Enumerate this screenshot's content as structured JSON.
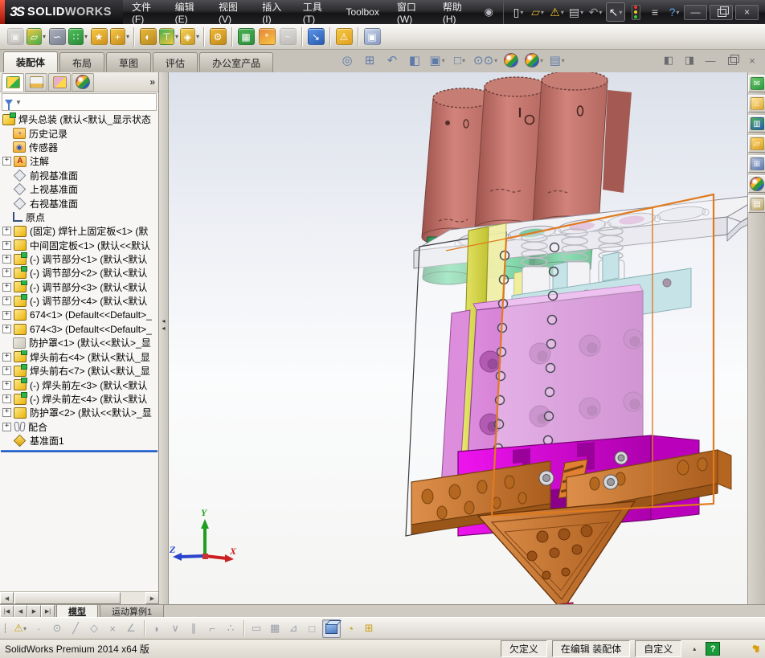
{
  "titlebar": {
    "logo_mark": "3S",
    "logo_brand_a": "SOLID",
    "logo_brand_b": "WORKS",
    "menus": [
      "文件(F)",
      "编辑(E)",
      "视图(V)",
      "插入(I)",
      "工具(T)",
      "Toolbox",
      "窗口(W)",
      "帮助(H)"
    ],
    "quick_tools": [
      {
        "name": "new-document",
        "glyph": "▯",
        "color": "#e8e8ec",
        "dropdown": true
      },
      {
        "name": "open",
        "glyph": "▱",
        "color": "#e8b83a",
        "dropdown": true
      },
      {
        "name": "save",
        "glyph": "⚠",
        "color": "#f0c030",
        "dropdown": true
      },
      {
        "name": "print",
        "glyph": "▤",
        "color": "#c8c8cc",
        "dropdown": true
      },
      {
        "name": "undo",
        "glyph": "↶",
        "color": "#9a9aa0",
        "dropdown": true
      },
      {
        "name": "select-arrow",
        "glyph": "↖",
        "color": "#f0f0f0",
        "dropdown": true,
        "boxed": true
      },
      {
        "name": "rebuild-traffic-light",
        "special": "traffic"
      },
      {
        "name": "file-properties",
        "glyph": "≡",
        "color": "#c8c8cc"
      },
      {
        "name": "help",
        "glyph": "?",
        "color": "#5aa0e8",
        "dropdown": true
      }
    ],
    "window_controls": [
      {
        "name": "minimize-window",
        "glyph": "—"
      },
      {
        "name": "restore-window",
        "special": "restore"
      },
      {
        "name": "close-window",
        "glyph": "×"
      }
    ]
  },
  "assembly_toolbar": {
    "items": [
      {
        "name": "edit-component",
        "glyph": "▣",
        "c1": "#c8c8c8",
        "c2": "#9a9a9a",
        "disabled": true
      },
      {
        "name": "insert-components",
        "glyph": "▱",
        "c1": "#f5c842",
        "c2": "#3fae4a",
        "dropdown": true
      },
      {
        "name": "mate",
        "glyph": "∽",
        "c1": "#aab0bc",
        "c2": "#7a8090"
      },
      {
        "name": "linear-component-pattern",
        "glyph": "∷",
        "c1": "#4ec05a",
        "c2": "#2a8a38",
        "dropdown": true
      },
      {
        "name": "smart-fasteners",
        "glyph": "★",
        "c1": "#f5c842",
        "c2": "#d09020"
      },
      {
        "name": "move-component",
        "glyph": "+",
        "c1": "#f5c842",
        "c2": "#c88a20",
        "dropdown": true
      },
      {
        "name": "show-hidden-components",
        "glyph": "◐",
        "c1": "#e8b83a",
        "c2": "#b88a20",
        "sep": true
      },
      {
        "name": "assembly-features",
        "glyph": "⊤",
        "c1": "#3fae4a",
        "c2": "#f5c842",
        "dropdown": true
      },
      {
        "name": "reference-geometry",
        "glyph": "◈",
        "c1": "#f5d052",
        "c2": "#c89a28",
        "dropdown": true
      },
      {
        "name": "motion-study-gears",
        "glyph": "⚙",
        "c1": "#f0b83a",
        "c2": "#c08a18",
        "sep": true
      },
      {
        "name": "component-preview-window",
        "glyph": "▦",
        "c1": "#48b050",
        "c2": "#2f8f3f",
        "sep": true
      },
      {
        "name": "exploded-view",
        "glyph": "*",
        "c1": "#e8833a",
        "c2": "#f5c842"
      },
      {
        "name": "explode-line-sketch",
        "glyph": "~",
        "c1": "#c0c0c0",
        "c2": "#a0a0a0",
        "disabled": true
      },
      {
        "name": "instant3d",
        "glyph": "↘",
        "c1": "#5a96e8",
        "c2": "#2a5ab0",
        "sep": true
      },
      {
        "name": "large-design-review",
        "glyph": "⚠",
        "c1": "#f5c842",
        "c2": "#e0a020",
        "sep": true
      },
      {
        "name": "take-snapshot",
        "glyph": "▣",
        "c1": "#c8d4e8",
        "c2": "#8898c0",
        "sep": true
      }
    ]
  },
  "commandmanager": {
    "tabs": [
      {
        "label": "装配体",
        "active": true
      },
      {
        "label": "布局"
      },
      {
        "label": "草图"
      },
      {
        "label": "评估"
      },
      {
        "label": "办公室产品"
      }
    ]
  },
  "headsup": {
    "items": [
      {
        "name": "zoom-to-fit",
        "glyph": "◎"
      },
      {
        "name": "zoom-to-area",
        "glyph": "⊞"
      },
      {
        "name": "previous-view",
        "glyph": "↶"
      },
      {
        "name": "section-view",
        "glyph": "◧"
      },
      {
        "name": "view-orientation",
        "glyph": "▣",
        "dropdown": true
      },
      {
        "name": "display-style",
        "glyph": "□",
        "dropdown": true
      },
      {
        "name": "hide-show-items",
        "glyph": "⊙⊙",
        "dropdown": true
      },
      {
        "name": "edit-appearance",
        "special": "ball"
      },
      {
        "name": "apply-scene",
        "special": "ball",
        "dropdown": true
      },
      {
        "name": "view-settings",
        "glyph": "▤",
        "dropdown": true
      }
    ]
  },
  "doc_controls": [
    {
      "name": "pane-left",
      "glyph": "◧"
    },
    {
      "name": "pane-right",
      "glyph": "◨"
    },
    {
      "name": "minimize-document",
      "glyph": "—"
    },
    {
      "name": "restore-document",
      "special": "restore"
    },
    {
      "name": "close-document",
      "glyph": "×"
    }
  ],
  "feature_panel": {
    "tabs": [
      {
        "name": "featuremanager-tree",
        "active": true
      },
      {
        "name": "propertymanager"
      },
      {
        "name": "configurationmanager"
      },
      {
        "name": "displaymanager"
      }
    ],
    "expand_glyph": "»",
    "tree": {
      "items": [
        {
          "icon": "assembly",
          "label": "焊头总装  (默认<默认_显示状态"
        },
        {
          "icon": "history",
          "label": "历史记录"
        },
        {
          "icon": "sensors",
          "label": "传感器"
        },
        {
          "icon": "annotations",
          "label": "注解",
          "plus": true
        },
        {
          "icon": "plane",
          "label": "前视基准面"
        },
        {
          "icon": "plane",
          "label": "上视基准面"
        },
        {
          "icon": "plane",
          "label": "右视基准面"
        },
        {
          "icon": "origin",
          "label": "原点"
        },
        {
          "icon": "part",
          "label": "(固定) 焊针上固定板<1> (默",
          "plus": true
        },
        {
          "icon": "part",
          "label": "中间固定板<1> (默认<<默认",
          "plus": true
        },
        {
          "icon": "subassembly",
          "label": "(-) 调节部分<1> (默认<默认",
          "plus": true
        },
        {
          "icon": "subassembly",
          "label": "(-) 调节部分<2> (默认<默认",
          "plus": true
        },
        {
          "icon": "subassembly",
          "label": "(-) 调节部分<3> (默认<默认",
          "plus": true
        },
        {
          "icon": "subassembly",
          "label": "(-) 调节部分<4> (默认<默认",
          "plus": true
        },
        {
          "icon": "part",
          "label": "674<1> (Default<<Default>_",
          "plus": true
        },
        {
          "icon": "part",
          "label": "674<3> (Default<<Default>_",
          "plus": true
        },
        {
          "icon": "part-hidden",
          "label": "防护罩<1> (默认<<默认>_显"
        },
        {
          "icon": "subassembly",
          "label": "焊头前右<4> (默认<默认_显",
          "plus": true
        },
        {
          "icon": "subassembly",
          "label": "焊头前右<7> (默认<默认_显",
          "plus": true
        },
        {
          "icon": "subassembly",
          "label": "(-) 焊头前左<3> (默认<默认",
          "plus": true
        },
        {
          "icon": "subassembly",
          "label": "(-) 焊头前左<4> (默认<默认",
          "plus": true
        },
        {
          "icon": "part",
          "label": "防护罩<2> (默认<<默认>_显",
          "plus": true
        },
        {
          "icon": "mates",
          "label": "配合",
          "plus": true
        },
        {
          "icon": "plane-gold",
          "label": "基准面1"
        }
      ]
    }
  },
  "taskpane": {
    "items": [
      {
        "name": "solidworks-forum",
        "glyph": "✉",
        "c1": "#6ac86a",
        "c2": "#2f9a3f"
      },
      {
        "name": "solidworks-resources",
        "glyph": "⌂",
        "c1": "#ffe8a0",
        "c2": "#e0a830"
      },
      {
        "name": "design-library",
        "glyph": "▥",
        "c1": "#4ab060",
        "c2": "#2a5ab0"
      },
      {
        "name": "file-explorer",
        "glyph": "▱",
        "c1": "#ffd878",
        "c2": "#d8a020"
      },
      {
        "name": "view-palette",
        "glyph": "⊞",
        "c1": "#b8c4d8",
        "c2": "#5a78b0"
      },
      {
        "name": "appearances-scenes",
        "special": "ball"
      },
      {
        "name": "custom-properties",
        "glyph": "▤",
        "c1": "#e8e4da",
        "c2": "#c0a860"
      }
    ]
  },
  "viewport": {
    "triad": {
      "x": "X",
      "y": "Y",
      "z": "Z"
    },
    "model_colors": {
      "salmon": "#c4766e",
      "salmon_dark": "#a2564f",
      "green": "#2fae63",
      "green_dark": "#1d8348",
      "plate": "#f2f2f5",
      "yellow": "#dede52",
      "cyan": "#a8d8da",
      "orchid": "#cf72cf",
      "orchid_dark": "#b055b0",
      "magenta": "#d800d8",
      "magenta_dark": "#9a009a",
      "orange": "#cd7a35",
      "orange_dark": "#a2591c",
      "selection": "#e07a1e",
      "pin": "#d42a5a",
      "bg_top": "#dbe0ea",
      "bg_bottom": "#f4f4f2"
    }
  },
  "bottom_tabs": {
    "nav": [
      {
        "name": "first-tab",
        "glyph": "|◀"
      },
      {
        "name": "previous-tab",
        "glyph": "◀"
      },
      {
        "name": "next-tab",
        "glyph": "▶"
      },
      {
        "name": "last-tab",
        "glyph": "▶|"
      }
    ],
    "tabs": [
      {
        "label": "模型",
        "active": true
      },
      {
        "label": "运动算例1"
      }
    ]
  },
  "snap_toolbar": {
    "items": [
      {
        "name": "sketch-snaps",
        "glyph": "⚠",
        "colored": true,
        "dropdown": true
      },
      {
        "name": "point-snap",
        "glyph": "·"
      },
      {
        "name": "center-snap",
        "glyph": "⊙"
      },
      {
        "name": "line-snap",
        "glyph": "╱"
      },
      {
        "name": "polygon-snap",
        "glyph": "◇"
      },
      {
        "name": "intersection-snap",
        "glyph": "×"
      },
      {
        "name": "angle-snap",
        "glyph": "∠"
      },
      {
        "name": "tangent-snap",
        "glyph": "◗",
        "sep": true
      },
      {
        "name": "midpoint-snap",
        "glyph": "∨"
      },
      {
        "name": "parallel-snap",
        "glyph": "∥"
      },
      {
        "name": "perpendicular-snap",
        "glyph": "⌐"
      },
      {
        "name": "point-trace-snap",
        "glyph": "∴"
      },
      {
        "name": "length-snap",
        "glyph": "▭",
        "sep": true
      },
      {
        "name": "grid-snap",
        "glyph": "▦"
      },
      {
        "name": "angle-grid-snap",
        "glyph": "⊿"
      },
      {
        "name": "wireframe-view",
        "glyph": "□"
      },
      {
        "name": "shaded-view",
        "special": "cube",
        "active": true
      },
      {
        "name": "measure",
        "glyph": "◔",
        "colored": true
      },
      {
        "name": "viewport-split",
        "glyph": "⊞",
        "colored": true
      }
    ]
  },
  "statusbar": {
    "left": "SolidWorks Premium 2014 x64 版",
    "cells": [
      {
        "label": "欠定义"
      },
      {
        "label": "在编辑 装配体"
      },
      {
        "label": "自定义",
        "caret": true
      }
    ],
    "help_glyph": "?"
  }
}
